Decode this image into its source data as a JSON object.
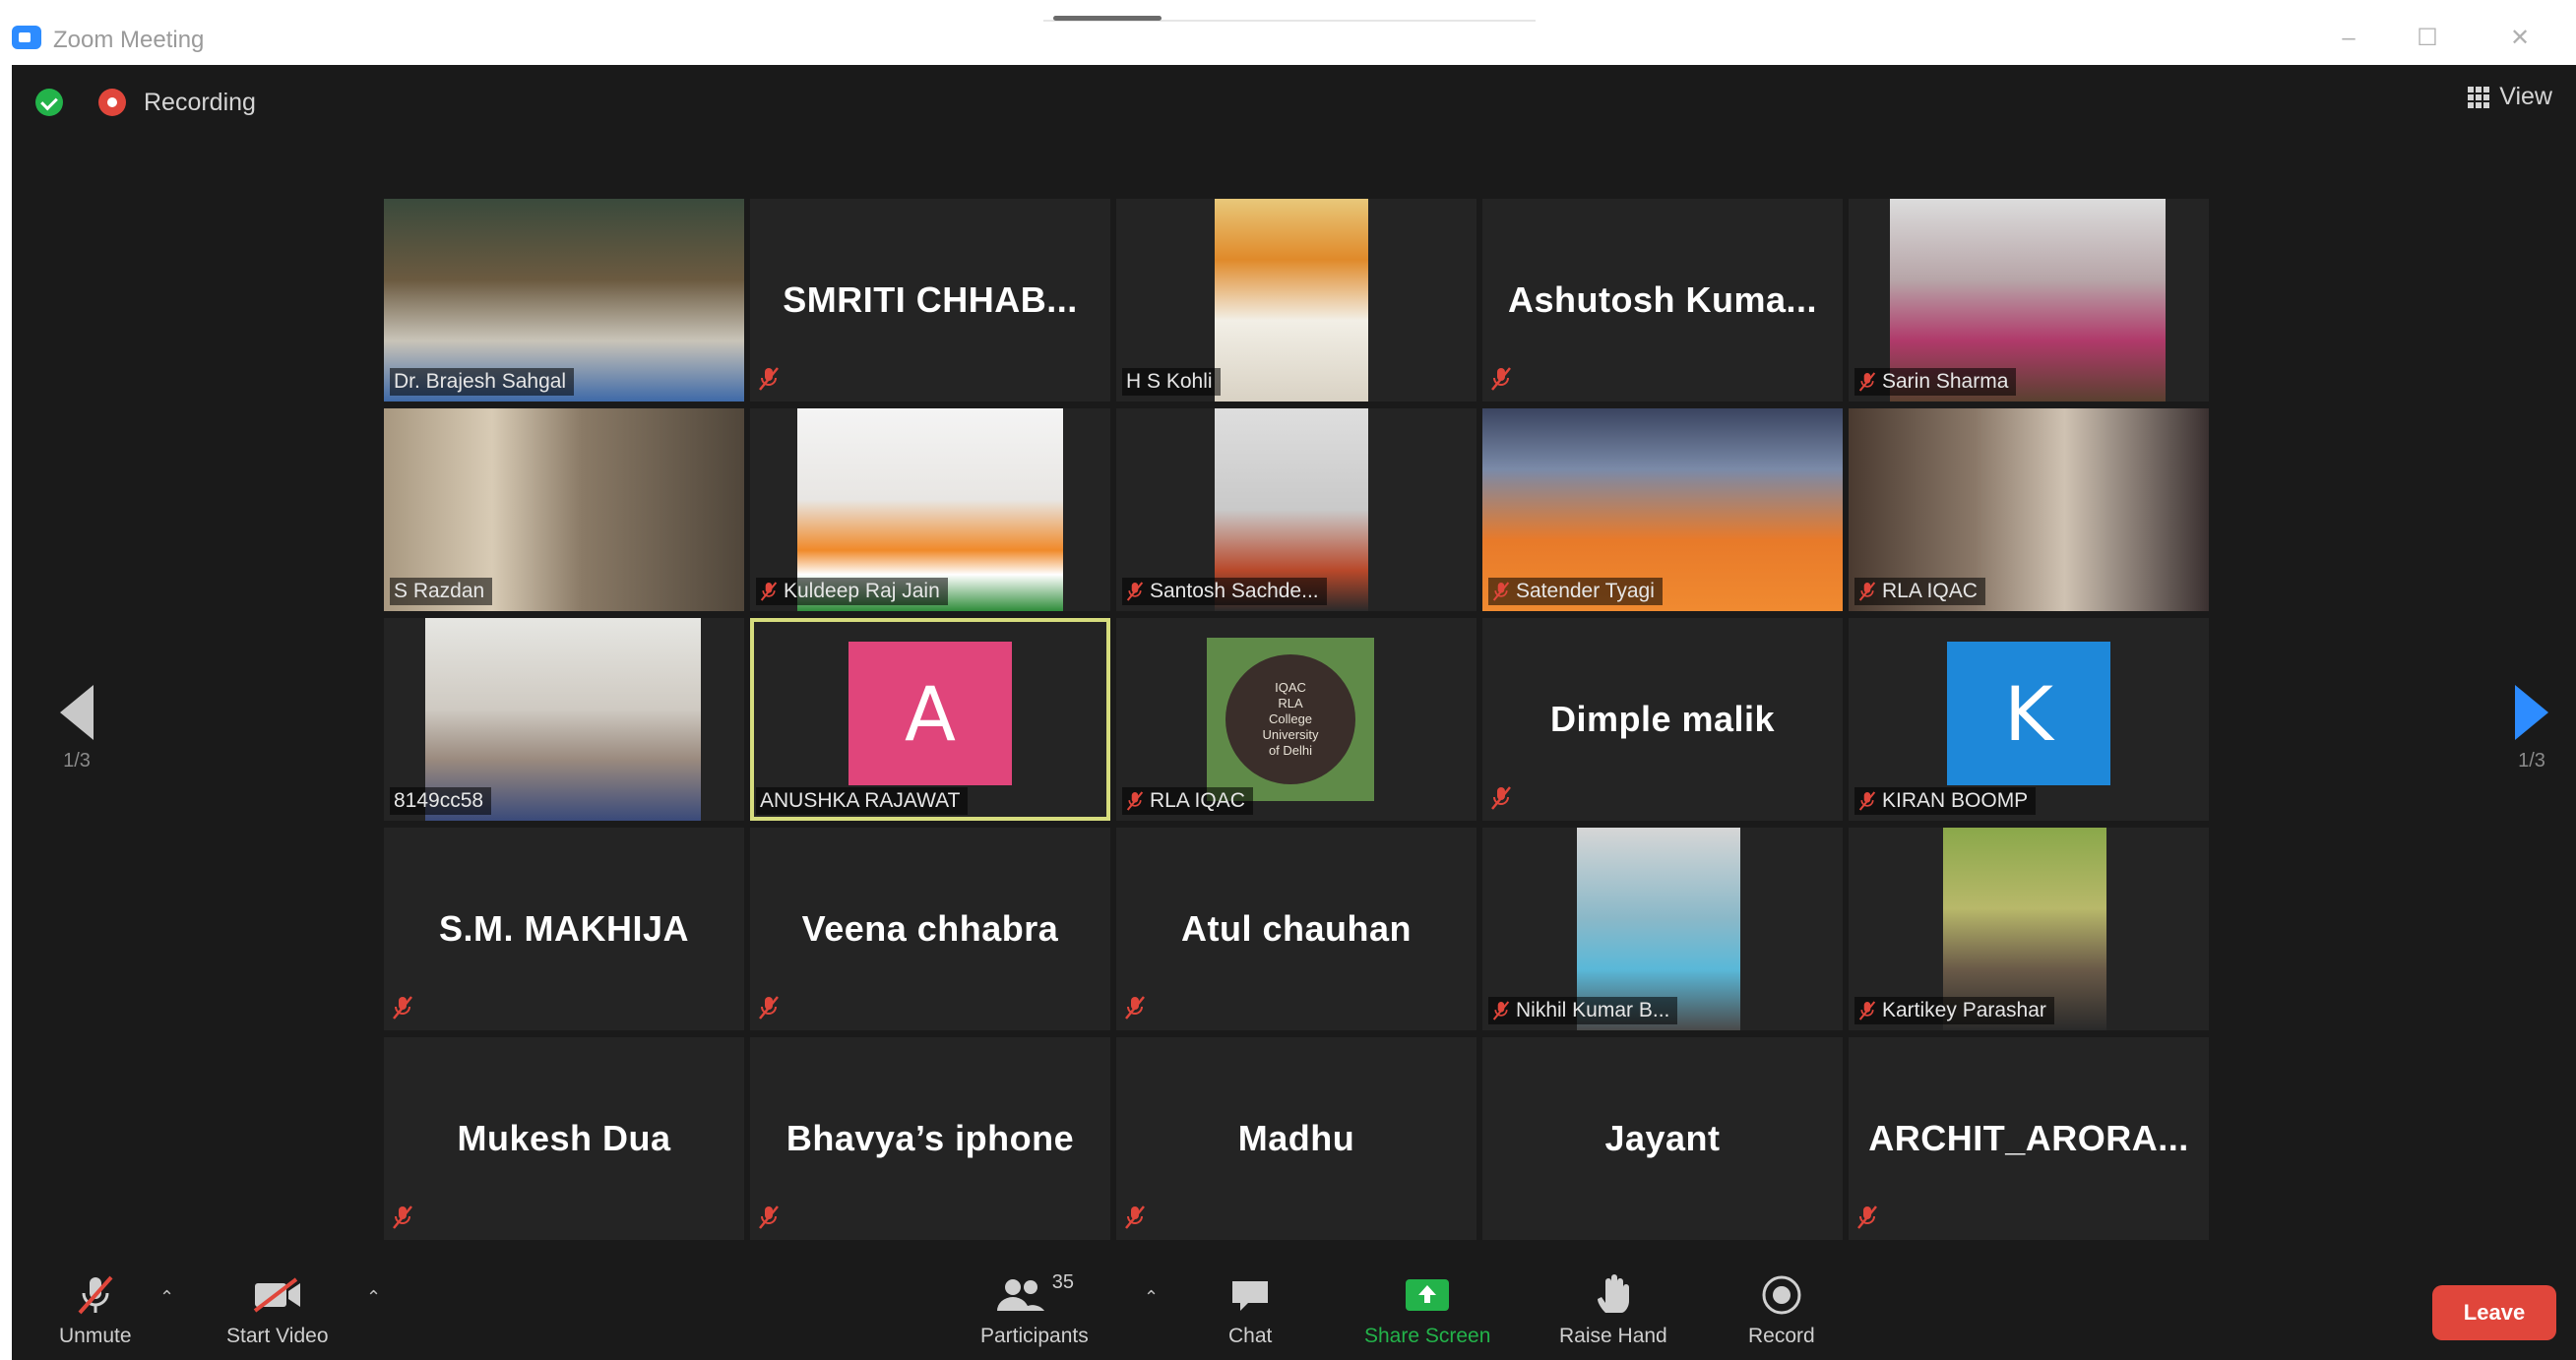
{
  "window": {
    "title": "Zoom Meeting",
    "controls": [
      "minimize",
      "maximize",
      "close"
    ]
  },
  "status": {
    "recording_label": "Recording"
  },
  "view": {
    "label": "View"
  },
  "gallery": {
    "pager_left": "1/3",
    "pager_right": "1/3",
    "tiles": [
      {
        "name": "Dr. Brajesh Sahgal",
        "mode": "video",
        "muted": false
      },
      {
        "name": "SMRITI CHHAB...",
        "mode": "name",
        "muted": true
      },
      {
        "name": "H S Kohli",
        "mode": "video",
        "muted": false
      },
      {
        "name": "Ashutosh Kuma...",
        "mode": "name",
        "muted": true
      },
      {
        "name": "Sarin Sharma",
        "mode": "video",
        "muted": true
      },
      {
        "name": "S Razdan",
        "mode": "video",
        "muted": false
      },
      {
        "name": "Kuldeep Raj Jain",
        "mode": "video",
        "muted": true
      },
      {
        "name": "Santosh Sachde...",
        "mode": "video",
        "muted": true
      },
      {
        "name": "Satender Tyagi",
        "mode": "video",
        "muted": true
      },
      {
        "name": "RLA IQAC",
        "mode": "video",
        "muted": true
      },
      {
        "name": "8149cc58",
        "mode": "video",
        "muted": false
      },
      {
        "name": "ANUSHKA RAJAWAT",
        "mode": "avatar",
        "avatar_letter": "A",
        "avatar_color": "#e0457b",
        "muted": false,
        "active_speaker": true
      },
      {
        "name": "RLA IQAC",
        "mode": "logo",
        "muted": true,
        "logo_text": [
          "IQAC",
          "RLA",
          "College",
          "University",
          "of Delhi"
        ]
      },
      {
        "name": "Dimple malik",
        "mode": "name",
        "muted": true
      },
      {
        "name": "KIRAN BOOMP",
        "mode": "avatar",
        "avatar_letter": "K",
        "avatar_color": "#1e88d9",
        "muted": true
      },
      {
        "name": "S.M. MAKHIJA",
        "mode": "name",
        "muted": true
      },
      {
        "name": "Veena chhabra",
        "mode": "name",
        "muted": true
      },
      {
        "name": "Atul chauhan",
        "mode": "name",
        "muted": true
      },
      {
        "name": "Nikhil Kumar B...",
        "mode": "video",
        "muted": true
      },
      {
        "name": "Kartikey Parashar",
        "mode": "video",
        "muted": true
      },
      {
        "name": "Mukesh Dua",
        "mode": "name",
        "muted": true
      },
      {
        "name": "Bhavya’s iphone",
        "mode": "name",
        "muted": true
      },
      {
        "name": "Madhu",
        "mode": "name",
        "muted": true
      },
      {
        "name": "Jayant",
        "mode": "name",
        "muted": false
      },
      {
        "name": "ARCHIT_ARORA...",
        "mode": "name",
        "muted": true
      }
    ]
  },
  "toolbar": {
    "unmute_label": "Unmute",
    "start_video_label": "Start Video",
    "participants_label": "Participants",
    "participants_count": "35",
    "chat_label": "Chat",
    "share_label": "Share Screen",
    "raise_hand_label": "Raise Hand",
    "record_label": "Record",
    "leave_label": "Leave",
    "share_color": "#23b34a",
    "leave_color": "#e0463b"
  }
}
